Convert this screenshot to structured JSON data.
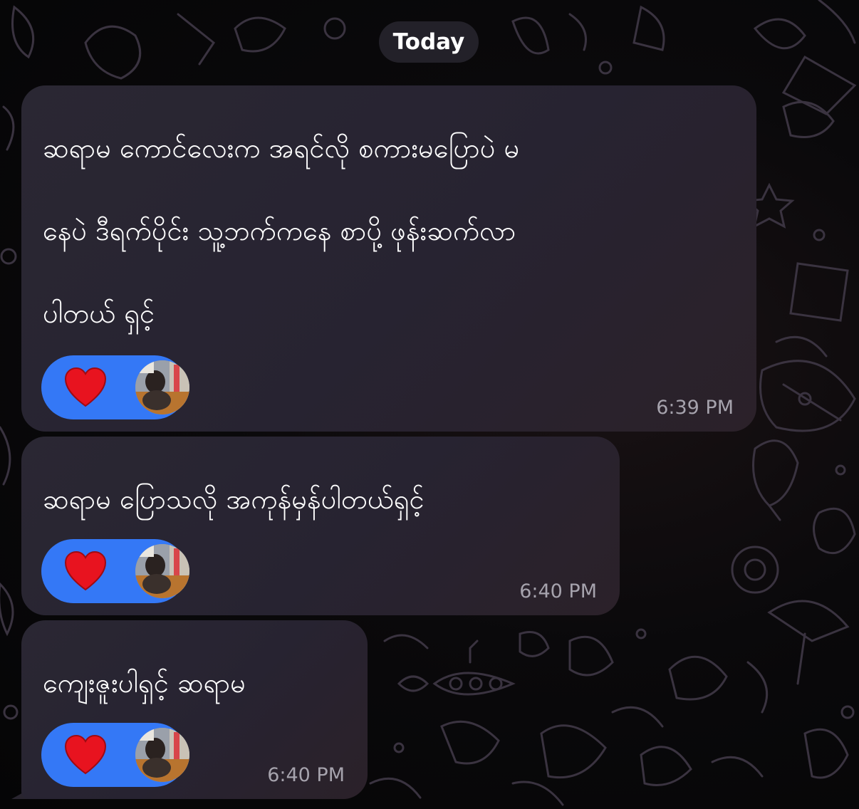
{
  "date_separator": "Today",
  "messages": [
    {
      "text": "ဆရာမ ကောင်လေးက အရင်လို စကားမပြောပဲ မ\nနေပဲ ဒီရက်ပိုင်း သူ့ဘက်ကနေ စာပို့ ဖုန်းဆက်လာ\nပါတယ် ရှင့်",
      "time": "6:39 PM",
      "reaction": "heart-icon"
    },
    {
      "text": "ဆရာမ ပြောသလို အကုန်မှန်ပါတယ်ရှင့်",
      "time": "6:40 PM",
      "reaction": "heart-icon"
    },
    {
      "text": "ကျေးဇူးပါရှင့် ဆရာမ",
      "time": "6:40 PM",
      "reaction": "heart-icon"
    }
  ],
  "colors": {
    "reaction_pill": "#3478f6",
    "heart": "#e8131f",
    "bubble": "#29252f",
    "timestamp": "#a6a3ad"
  }
}
